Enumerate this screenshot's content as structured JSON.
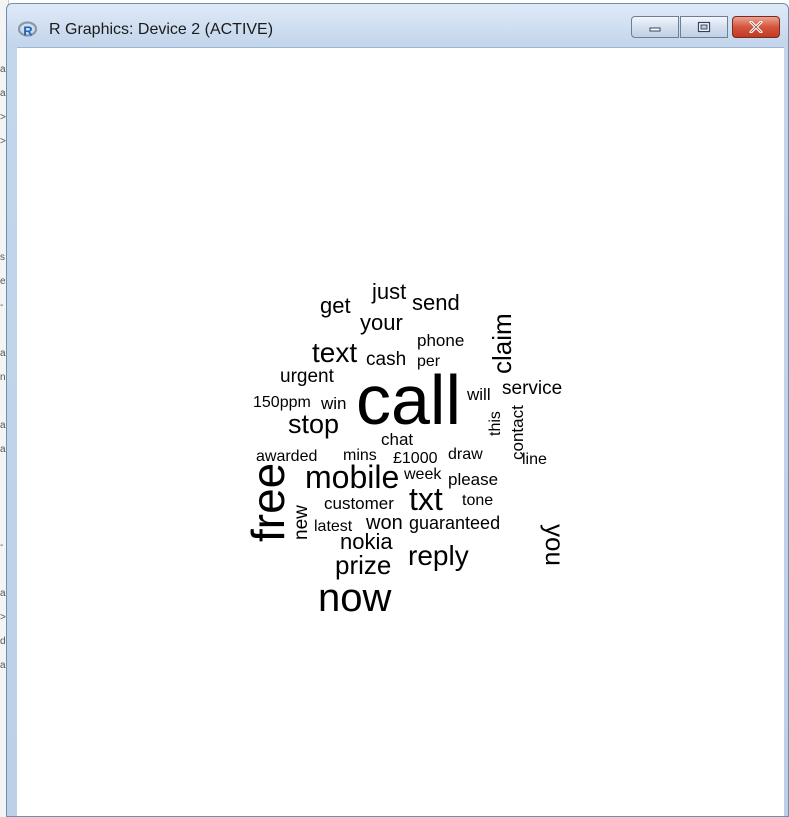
{
  "window": {
    "title": "R Graphics: Device 2 (ACTIVE)",
    "controls": [
      "minimize",
      "maximize",
      "close"
    ]
  },
  "wordcloud": {
    "words": [
      "call",
      "now",
      "free",
      "mobile",
      "txt",
      "reply",
      "text",
      "stop",
      "claim",
      "you",
      "prize",
      "your",
      "get",
      "just",
      "send",
      "nokia",
      "cash",
      "urgent",
      "service",
      "contact",
      "won",
      "guaranteed",
      "customer",
      "new",
      "latest",
      "chat",
      "phone",
      "per",
      "will",
      "this",
      "150ppm",
      "win",
      "awarded",
      "mins",
      "£1000",
      "draw",
      "line",
      "week",
      "please",
      "tone"
    ]
  }
}
